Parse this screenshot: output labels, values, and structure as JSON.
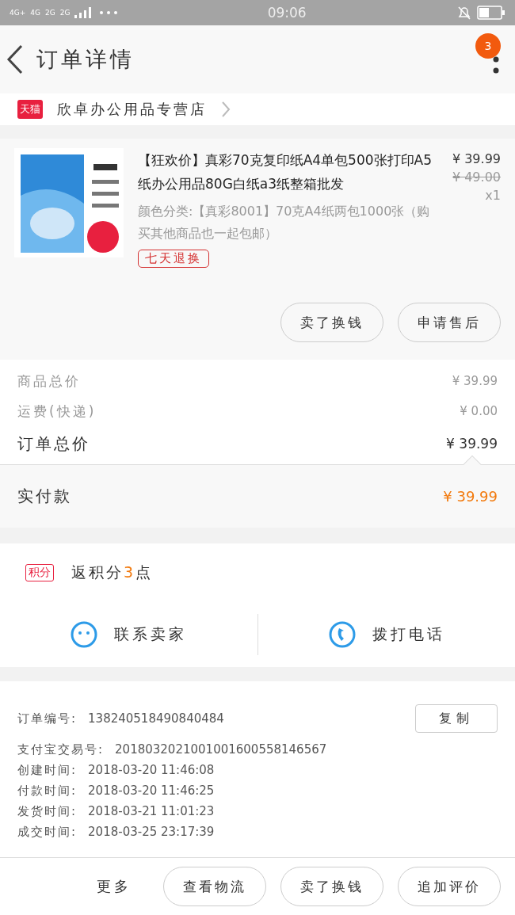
{
  "status_bar": {
    "network_labels": [
      "4G+",
      "4G",
      "2G",
      "2G"
    ],
    "time": "09:06"
  },
  "header": {
    "title": "订单详情",
    "badge": "3"
  },
  "store": {
    "tag": "天猫",
    "name": "欣卓办公用品专营店"
  },
  "product": {
    "image": {
      "kind": "picture"
    },
    "title": "【狂欢价】真彩70克复印纸A4单包500张打印A5纸办公用品80G白纸a3纸整箱批发",
    "price": "¥ 39.99",
    "original_price": "¥ 49.00",
    "sku": "颜色分类:【真彩8001】70克A4纸两包1000张（购买其他商品也一起包邮）",
    "quantity": "x1",
    "service_tag": "七天退换",
    "buttons": [
      "卖了换钱",
      "申请售后"
    ]
  },
  "summary": [
    {
      "label": "商品总价",
      "value": "¥ 39.99",
      "kind": "minor"
    },
    {
      "label": "运费(快递)",
      "value": "¥ 0.00",
      "kind": "minor"
    },
    {
      "label": "订单总价",
      "value": "¥ 39.99",
      "kind": "major"
    }
  ],
  "payment": {
    "label": "实付款",
    "value": "¥ 39.99"
  },
  "points": {
    "tag": "积分",
    "prefix": "返积分",
    "number": "3",
    "suffix": "点"
  },
  "contact": [
    {
      "label": "联系卖家",
      "kind": "chat"
    },
    {
      "label": "拨打电话",
      "kind": "phone"
    }
  ],
  "order_info": {
    "order_number_label": "订单编号:",
    "order_number": "138240518490840484",
    "copy_button": "复制",
    "rows": [
      {
        "label": "支付宝交易号:",
        "value": "2018032021001001600558146567"
      },
      {
        "label": "创建时间:",
        "value": "2018-03-20 11:46:08"
      },
      {
        "label": "付款时间:",
        "value": "2018-03-20 11:46:25"
      },
      {
        "label": "发货时间:",
        "value": "2018-03-21 11:01:23"
      },
      {
        "label": "成交时间:",
        "value": "2018-03-25 23:17:39"
      }
    ]
  },
  "bottom_bar": {
    "more": "更多",
    "buttons": [
      "查看物流",
      "卖了换钱",
      "追加评价"
    ]
  }
}
